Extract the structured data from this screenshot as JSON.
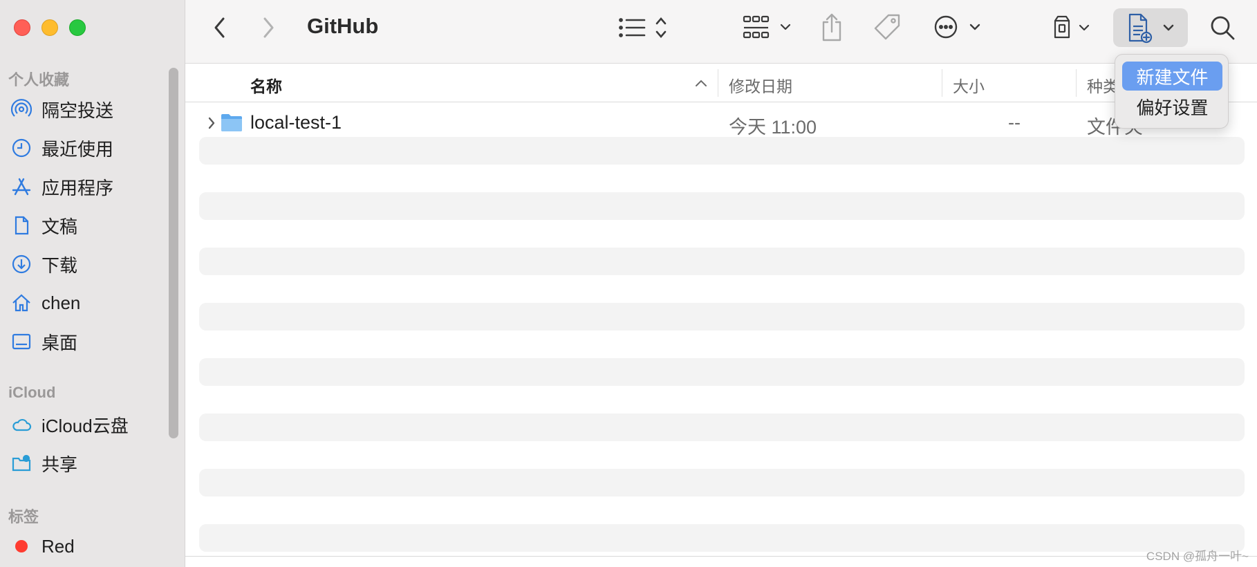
{
  "window": {
    "title": "GitHub"
  },
  "sidebar": {
    "favorites_header": "个人收藏",
    "favorites": [
      {
        "label": "隔空投送",
        "icon": "airdrop-icon"
      },
      {
        "label": "最近使用",
        "icon": "clock-icon"
      },
      {
        "label": "应用程序",
        "icon": "appstore-icon"
      },
      {
        "label": "文稿",
        "icon": "document-icon"
      },
      {
        "label": "下载",
        "icon": "download-icon"
      },
      {
        "label": "chen",
        "icon": "home-icon"
      },
      {
        "label": "桌面",
        "icon": "desktop-icon"
      }
    ],
    "icloud_header": "iCloud",
    "icloud": [
      {
        "label": "iCloud云盘",
        "icon": "cloud-icon"
      },
      {
        "label": "共享",
        "icon": "shared-folder-icon"
      }
    ],
    "tags_header": "标签",
    "tags": [
      {
        "label": "Red",
        "color": "#ff3b30"
      }
    ]
  },
  "columns": {
    "name": "名称",
    "modified": "修改日期",
    "size": "大小",
    "kind": "种类"
  },
  "files": [
    {
      "name": "local-test-1",
      "modified": "今天 11:00",
      "size": "--",
      "kind": "文件夹"
    }
  ],
  "menu": {
    "items": [
      "新建文件",
      "偏好设置"
    ],
    "highlighted_index": 0
  },
  "colors": {
    "accent": "#6a9ef0",
    "icon_blue": "#2f7be0",
    "folder_blue": "#6cb0f0"
  },
  "watermark": "CSDN @孤舟一叶~"
}
